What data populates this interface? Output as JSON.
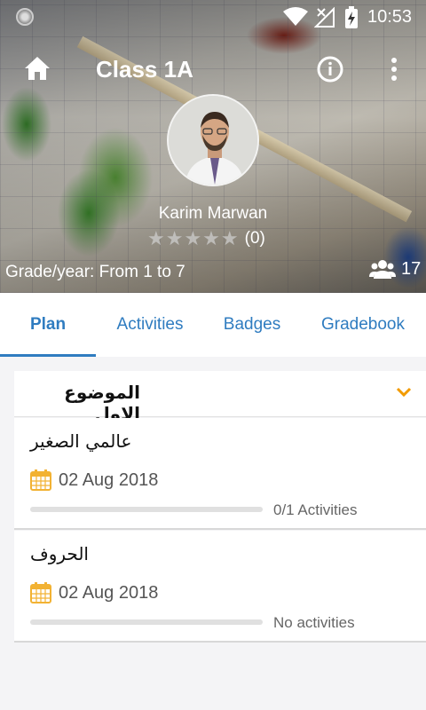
{
  "status_bar": {
    "time": "10:53"
  },
  "app_bar": {
    "title": "Class 1A"
  },
  "profile": {
    "teacher_name": "Karim Marwan",
    "rating_stars": "★★★★★",
    "rating_count": "(0)",
    "grade_text": "Grade/year: From 1 to 7",
    "students_count": "17"
  },
  "tabs": [
    {
      "label": "Plan",
      "active": true
    },
    {
      "label": "Activities",
      "active": false
    },
    {
      "label": "Badges",
      "active": false
    },
    {
      "label": "Gradebook",
      "active": false
    }
  ],
  "section": {
    "title": "الموضوع الاول"
  },
  "lessons": [
    {
      "title": "عالمي الصغير",
      "date": "02 Aug 2018",
      "status": "0/1 Activities",
      "progress": 0
    },
    {
      "title": "الحروف",
      "date": "02 Aug 2018",
      "status": "No activities",
      "progress": 0
    }
  ],
  "colors": {
    "accent": "#2f7cc0",
    "chevron": "#f29b00",
    "calendar": "#f2b233"
  }
}
